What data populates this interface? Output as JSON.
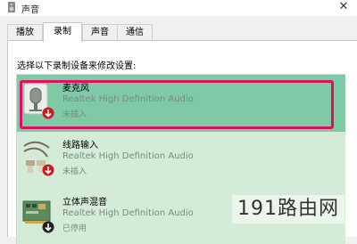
{
  "window": {
    "title": "声音",
    "close": "✕"
  },
  "tabs": [
    {
      "label": "播放",
      "active": false
    },
    {
      "label": "录制",
      "active": true
    },
    {
      "label": "声音",
      "active": false
    },
    {
      "label": "通信",
      "active": false
    }
  ],
  "instruction": "选择以下录制设备来修改设置:",
  "devices": [
    {
      "name": "麦克风",
      "description": "Realtek High Definition Audio",
      "status": "未插入",
      "icon": "microphone-icon",
      "state_icon": "unplugged-arrow-icon",
      "selected": true
    },
    {
      "name": "线路输入",
      "description": "Realtek High Definition Audio",
      "status": "未插入",
      "icon": "line-in-icon",
      "state_icon": "unplugged-arrow-icon",
      "selected": false
    },
    {
      "name": "立体声混音",
      "description": "Realtek High Definition Audio",
      "status": "已停用",
      "icon": "stereo-mix-icon",
      "state_icon": "disabled-arrow-icon",
      "selected": false
    }
  ],
  "watermark": "191路由网",
  "colors": {
    "selection": "#7fc9a6",
    "list_background": "#d4ecd7",
    "highlight_border": "#e01060",
    "status_arrow": "#d01820"
  }
}
